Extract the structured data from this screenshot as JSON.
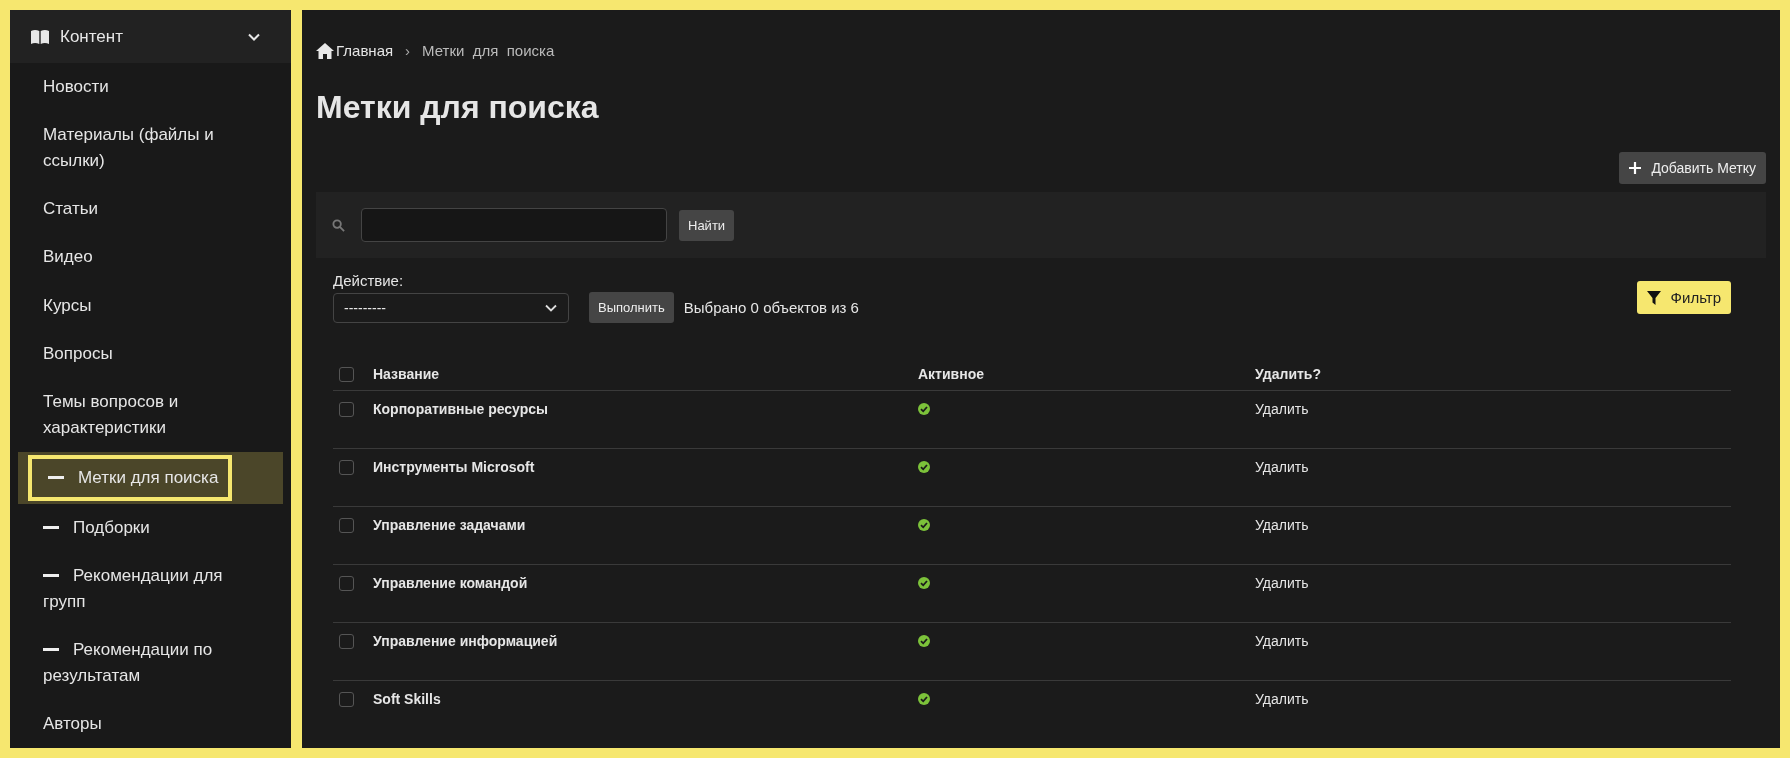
{
  "sidebar": {
    "section": {
      "label": "Контент",
      "expanded": true
    },
    "items": [
      {
        "label": "Новости",
        "kind": "plain",
        "selected": false
      },
      {
        "label": "Материалы (файлы и ссылки)",
        "kind": "plain",
        "selected": false
      },
      {
        "label": "Статьи",
        "kind": "plain",
        "selected": false
      },
      {
        "label": "Видео",
        "kind": "plain",
        "selected": false
      },
      {
        "label": "Курсы",
        "kind": "plain",
        "selected": false
      },
      {
        "label": "Вопросы",
        "kind": "plain",
        "selected": false
      },
      {
        "label": "Темы вопросов и характеристики",
        "kind": "plain",
        "selected": false
      },
      {
        "label": "Метки для поиска",
        "kind": "dash",
        "selected": true
      },
      {
        "label": "Подборки",
        "kind": "dash",
        "selected": false
      },
      {
        "label": "Рекомендации для групп",
        "kind": "dash",
        "selected": false
      },
      {
        "label": "Рекомендации по результатам",
        "kind": "dash",
        "selected": false
      },
      {
        "label": "Авторы",
        "kind": "plain",
        "selected": false
      }
    ]
  },
  "breadcrumb": [
    {
      "label": "Главная"
    },
    {
      "label": "Метки  для  поиска"
    }
  ],
  "breadcrumb_separator": "›",
  "title": "Метки для поиска",
  "add_button": "Добавить Метку",
  "search": {
    "button": "Найти"
  },
  "action": {
    "label": "Действие:",
    "value": "---------",
    "button": "Выполнить",
    "selection_text": "Выбрано 0 объектов из 6"
  },
  "filter_button": "Фильтр",
  "table": {
    "columns": [
      {
        "label": "Название"
      },
      {
        "label": "Активное"
      },
      {
        "label": "Удалить?"
      }
    ],
    "header_checked": false,
    "rows": [
      {
        "name": "Корпоративные ресурсы",
        "active": true,
        "checked": false,
        "delete": "Удалить"
      },
      {
        "name": "Инструменты Microsoft",
        "active": true,
        "checked": false,
        "delete": "Удалить"
      },
      {
        "name": "Управление задачами",
        "active": true,
        "checked": false,
        "delete": "Удалить"
      },
      {
        "name": "Управление командой",
        "active": true,
        "checked": false,
        "delete": "Удалить"
      },
      {
        "name": "Управление информацией",
        "active": true,
        "checked": false,
        "delete": "Удалить"
      },
      {
        "name": "Soft Skills",
        "active": true,
        "checked": false,
        "delete": "Удалить"
      }
    ]
  }
}
